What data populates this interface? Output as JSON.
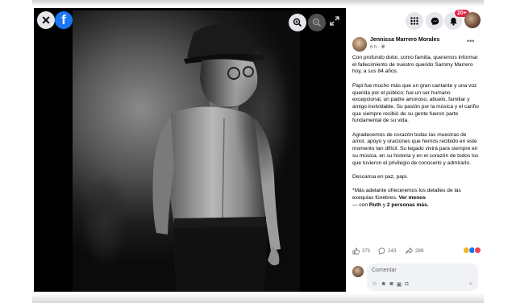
{
  "post": {
    "author": "Jennissa Marrero Morales",
    "time": "6 h",
    "paragraphs": [
      "Con profundo dolor, como familia, queremos informar el fallecimiento de nuestro querido Sammy Marrero hoy, a sus 84 años.",
      "Papi fue mucho más que un gran cantante y una voz querida por el público; fue un ser humano excepcional, un padre amoroso, abuelo, familiar y amigo inolvidable. Su pasión por la música y el cariño que siempre recibió de su gente fueron parte fundamental de su vida.",
      "Agradecemos de corazón todas las muestras de amor, apoyo y oraciones que hemos recibido en este momento tan difícil. Su legado vivirá para siempre en su música, en su historia y en el corazón de todos los que tuvieron el privilegio de conocerlo y admirarlo.",
      "Descansa en paz, papi."
    ],
    "closing": "*Más adelante ofreceremos los detalles de las exequias fúnebres.",
    "see_less": "Ver menos",
    "tagged_prefix": "— con",
    "tagged_names": "Ruth",
    "tagged_mid": "y",
    "tagged_others": "2 personas más."
  },
  "reactions": {
    "likes": "371",
    "comments": "243",
    "shares": "289"
  },
  "comment": {
    "placeholder": "Comentar"
  },
  "nav": {
    "notifications_badge": "20+"
  },
  "icons": {
    "close": "close-icon",
    "logo": "facebook-logo-icon",
    "zoom_in": "zoom-in-icon",
    "zoom_out": "zoom-out-icon",
    "expand": "expand-icon",
    "menu": "grid-menu-icon",
    "messenger": "messenger-icon",
    "bell": "bell-icon",
    "more": "more-options-icon"
  },
  "colors": {
    "facebook_blue": "#1877f2",
    "badge_red": "#e41e3f",
    "text_primary": "#050505",
    "text_secondary": "#65676b"
  }
}
